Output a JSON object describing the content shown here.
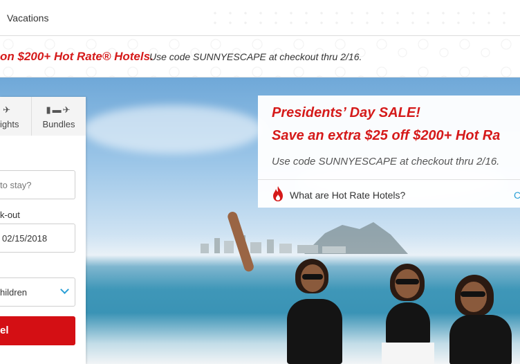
{
  "nav": {
    "vacations_label": "Vacations"
  },
  "promo": {
    "headline": "on $200+ Hot Rate® Hotels.",
    "code_text": "Use code SUNNYESCAPE at checkout thru 2/16."
  },
  "search": {
    "tabs": [
      {
        "label": "ights",
        "icon": "airplane-icon"
      },
      {
        "label": "Bundles",
        "icon": "hotel-car-flight-icon"
      }
    ],
    "where_placeholder": "to stay?",
    "checkout_label": "k-out",
    "checkout_date": "02/15/2018",
    "guests_value": "hildren",
    "search_button": "el"
  },
  "sale_card": {
    "title": "Presidents’ Day SALE!",
    "subtitle": "Save an extra $25 off $200+ Hot Ra",
    "code_text": "Use code SUNNYESCAPE at checkout thru 2/16.",
    "hot_rate_link": "What are Hot Rate Hotels?",
    "more_link": "C"
  },
  "colors": {
    "brand_red": "#d51a1a",
    "button_red": "#d40f14",
    "link_blue": "#2a9fd6"
  }
}
